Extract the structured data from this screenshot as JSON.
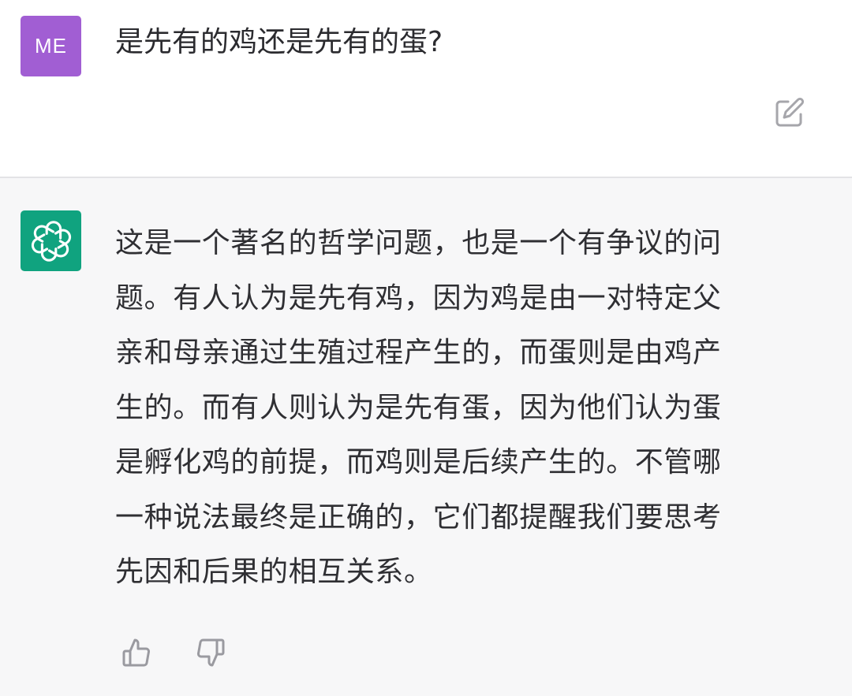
{
  "user_message": {
    "avatar_initials": "ME",
    "avatar_color": "#a15ed3",
    "text": "是先有的鸡还是先有的蛋?",
    "edit_icon": "edit-icon"
  },
  "assistant_message": {
    "avatar_icon": "openai-logo-icon",
    "avatar_color": "#10a37f",
    "lines": [
      "这是一个著名的哲学问题，也是一个有争议的问",
      "题。有人认为是先有鸡，因为鸡是由一对特定父",
      "亲和母亲通过生殖过程产生的，而蛋则是由鸡产",
      "生的。而有人则认为是先有蛋，因为他们认为蛋",
      "是孵化鸡的前提，而鸡则是后续产生的。不管哪",
      "一种说法最终是正确的，它们都提醒我们要思考",
      "先因和后果的相互关系。"
    ],
    "feedback": {
      "like_icon": "thumbs-up-icon",
      "dislike_icon": "thumbs-down-icon"
    }
  }
}
